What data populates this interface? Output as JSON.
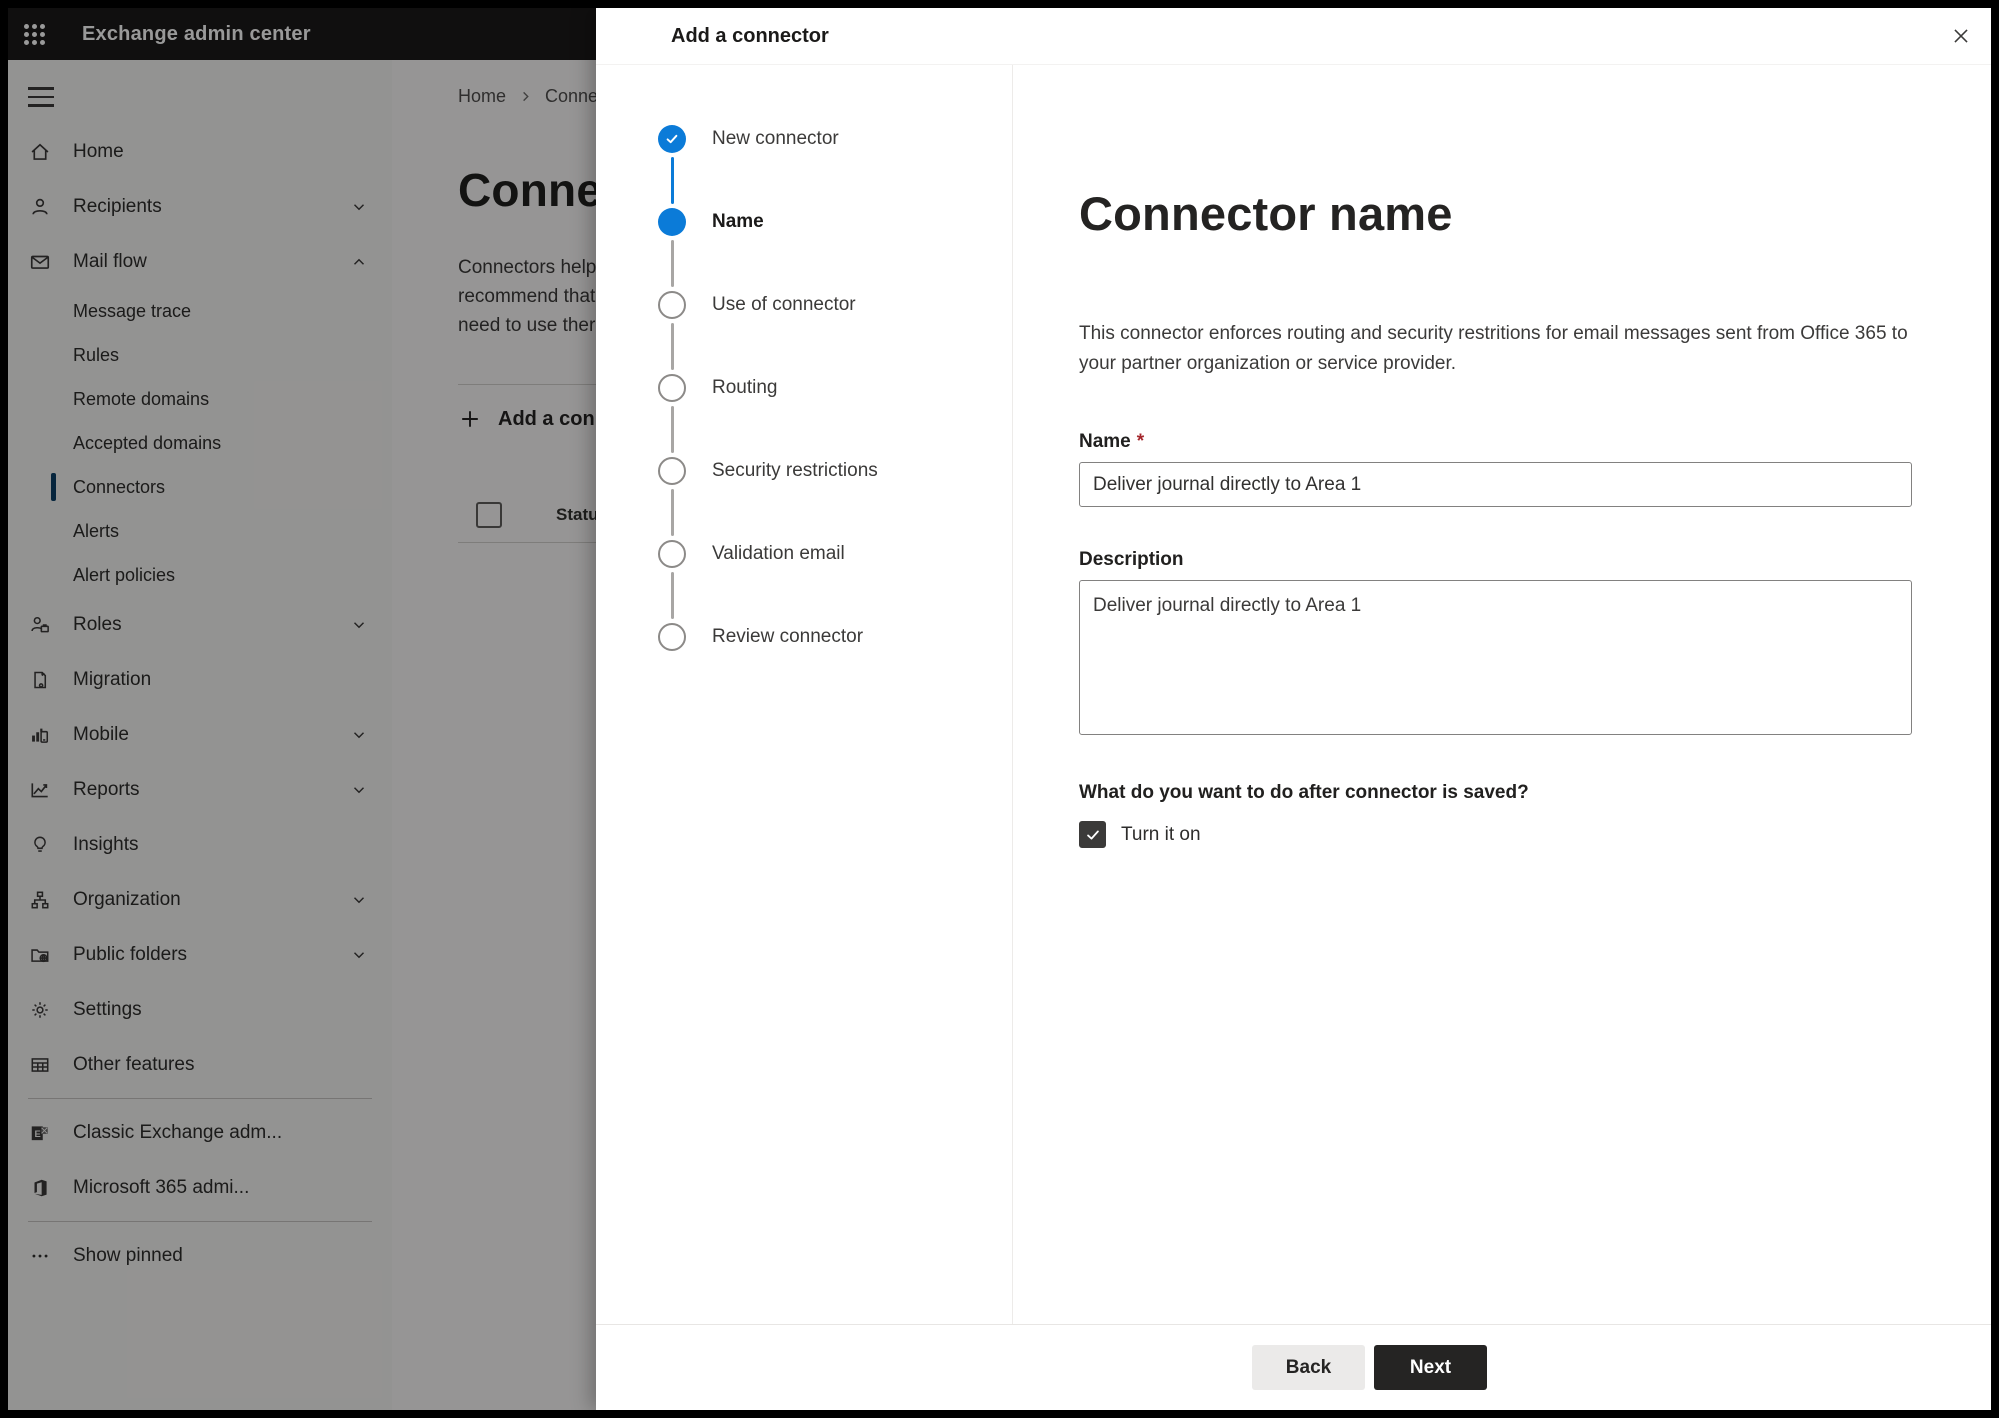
{
  "topbar": {
    "title": "Exchange admin center"
  },
  "sidebar": {
    "items": [
      {
        "label": "Home",
        "icon": "home-icon",
        "chevron": "none",
        "selected": false,
        "sub": false
      },
      {
        "label": "Recipients",
        "icon": "person-icon",
        "chevron": "down",
        "selected": false,
        "sub": false
      },
      {
        "label": "Mail flow",
        "icon": "mail-icon",
        "chevron": "up",
        "selected": false,
        "sub": false
      },
      {
        "label": "Message trace",
        "icon": "none",
        "chevron": "none",
        "selected": false,
        "sub": true
      },
      {
        "label": "Rules",
        "icon": "none",
        "chevron": "none",
        "selected": false,
        "sub": true
      },
      {
        "label": "Remote domains",
        "icon": "none",
        "chevron": "none",
        "selected": false,
        "sub": true
      },
      {
        "label": "Accepted domains",
        "icon": "none",
        "chevron": "none",
        "selected": false,
        "sub": true
      },
      {
        "label": "Connectors",
        "icon": "none",
        "chevron": "none",
        "selected": true,
        "sub": true
      },
      {
        "label": "Alerts",
        "icon": "none",
        "chevron": "none",
        "selected": false,
        "sub": true
      },
      {
        "label": "Alert policies",
        "icon": "none",
        "chevron": "none",
        "selected": false,
        "sub": true
      },
      {
        "label": "Roles",
        "icon": "roles-icon",
        "chevron": "down",
        "selected": false,
        "sub": false
      },
      {
        "label": "Migration",
        "icon": "migration-icon",
        "chevron": "none",
        "selected": false,
        "sub": false
      },
      {
        "label": "Mobile",
        "icon": "mobile-icon",
        "chevron": "down",
        "selected": false,
        "sub": false
      },
      {
        "label": "Reports",
        "icon": "reports-icon",
        "chevron": "down",
        "selected": false,
        "sub": false
      },
      {
        "label": "Insights",
        "icon": "insights-icon",
        "chevron": "none",
        "selected": false,
        "sub": false
      },
      {
        "label": "Organization",
        "icon": "organization-icon",
        "chevron": "down",
        "selected": false,
        "sub": false
      },
      {
        "label": "Public folders",
        "icon": "public-folders-icon",
        "chevron": "down",
        "selected": false,
        "sub": false
      },
      {
        "label": "Settings",
        "icon": "settings-gear-icon",
        "chevron": "none",
        "selected": false,
        "sub": false
      },
      {
        "label": "Other features",
        "icon": "other-features-icon",
        "chevron": "none",
        "selected": false,
        "sub": false
      }
    ],
    "footer_items": [
      {
        "label": "Classic Exchange adm...",
        "icon": "exchange-logo-icon"
      },
      {
        "label": "Microsoft 365 admi...",
        "icon": "microsoft-365-logo-icon"
      }
    ],
    "show_pinned": {
      "label": "Show pinned",
      "icon": "ellipsis-icon"
    }
  },
  "page": {
    "breadcrumb": [
      "Home",
      "Connectors"
    ],
    "title": "Connectors",
    "paragraph_lines": [
      "Connectors help",
      "recommend that",
      "need to use ther"
    ],
    "add_button_label": "Add a connector",
    "table": {
      "status_header": "Status"
    }
  },
  "modal": {
    "title": "Add a connector",
    "steps": [
      {
        "label": "New connector",
        "state": "completed"
      },
      {
        "label": "Name",
        "state": "current"
      },
      {
        "label": "Use of connector",
        "state": "upcoming"
      },
      {
        "label": "Routing",
        "state": "upcoming"
      },
      {
        "label": "Security restrictions",
        "state": "upcoming"
      },
      {
        "label": "Validation email",
        "state": "upcoming"
      },
      {
        "label": "Review connector",
        "state": "upcoming"
      }
    ],
    "content": {
      "heading": "Connector name",
      "description": "This connector enforces routing and security restritions for email messages sent from Office 365 to your partner organization or service provider.",
      "name_label": "Name",
      "required_mark": "*",
      "name_value": "Deliver journal directly to Area 1",
      "description_label": "Description",
      "description_value": "Deliver journal directly to Area 1",
      "after_save_question": "What do you want to do after connector is saved?",
      "turn_it_on_label": "Turn it on",
      "turn_it_on_checked": true
    },
    "footer": {
      "back_label": "Back",
      "next_label": "Next"
    }
  },
  "colors": {
    "accent_blue": "#0b7bd8",
    "topbar_bg": "#1b1a19",
    "next_button_bg": "#252423",
    "back_button_bg": "#ebeae9",
    "checkbox_bg": "#3b3a39",
    "required_red": "#a4262c"
  },
  "icons": [
    "app-launcher-icon",
    "hamburger-icon",
    "home-icon",
    "person-icon",
    "mail-icon",
    "chevron-down-icon",
    "chevron-up-icon",
    "roles-icon",
    "migration-icon",
    "mobile-icon",
    "reports-icon",
    "insights-icon",
    "organization-icon",
    "public-folders-icon",
    "settings-gear-icon",
    "other-features-icon",
    "exchange-logo-icon",
    "microsoft-365-logo-icon",
    "ellipsis-icon",
    "plus-icon",
    "close-icon",
    "check-icon",
    "checkbox-unchecked-icon"
  ]
}
